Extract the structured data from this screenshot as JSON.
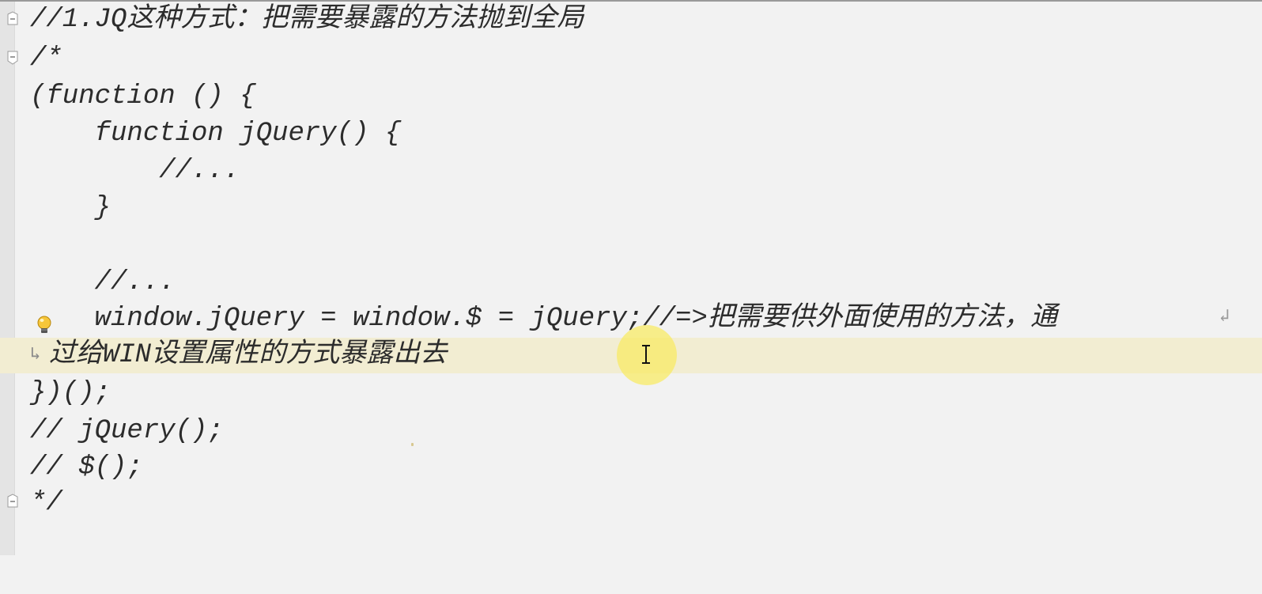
{
  "editor": {
    "lines": [
      "//1.JQ这种方式：把需要暴露的方法抛到全局",
      "/*",
      "(function () {",
      "    function jQuery() {",
      "        //...",
      "    }",
      "",
      "    //...",
      "    window.jQuery = window.$ = jQuery;//=>把需要供外面使用的方法，通",
      "过给WIN设置属性的方式暴露出去",
      "})();",
      "// jQuery();",
      "// $();",
      "*/"
    ],
    "wrap_marker_end": "↲",
    "wrap_marker_start": "↳",
    "intention_icon": "lightbulb-icon",
    "fold_icons": [
      "fold-minus-icon",
      "fold-minus-icon",
      "fold-end-icon"
    ],
    "colors": {
      "background": "#f2f2f2",
      "current_line": "#f2edd2",
      "text": "#2c2c2c",
      "cursor_highlight": "#f8ea60"
    }
  }
}
